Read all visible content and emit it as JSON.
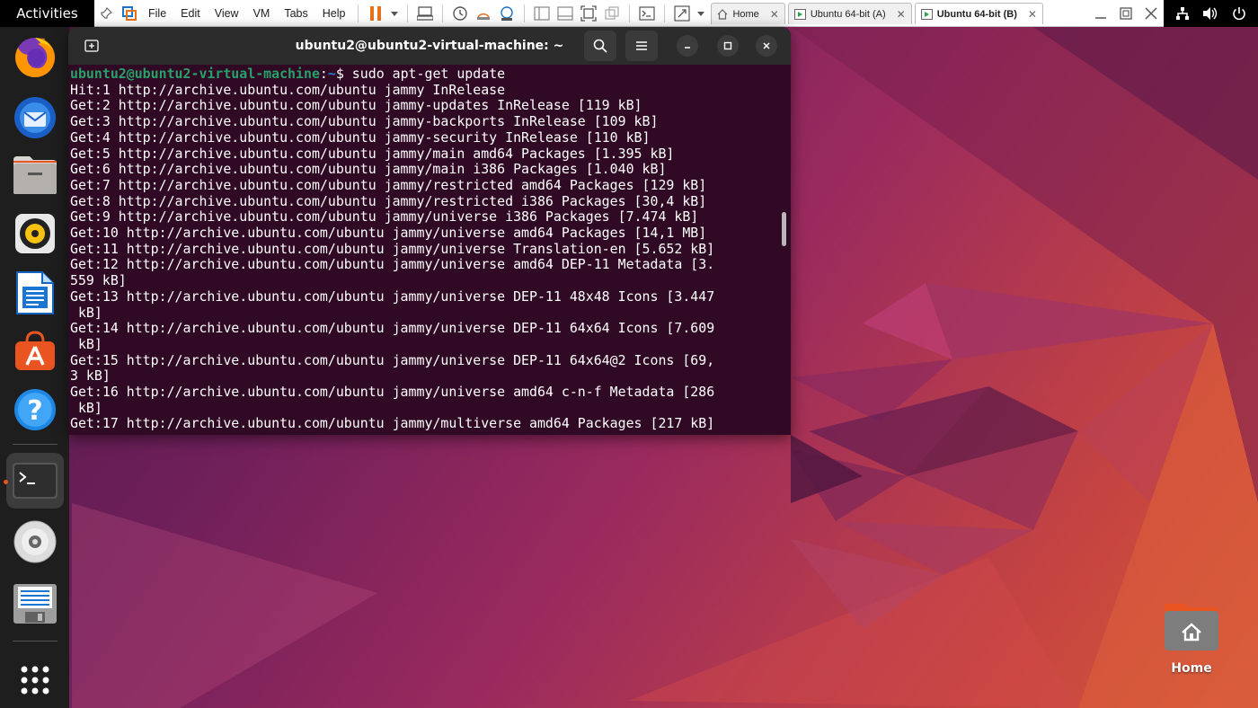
{
  "topbar": {
    "activities_label": "Activities"
  },
  "vmware": {
    "menu": [
      "File",
      "Edit",
      "View",
      "VM",
      "Tabs",
      "Help"
    ],
    "tabs": [
      {
        "label": "Home",
        "active": false
      },
      {
        "label": "Ubuntu 64-bit (A)",
        "active": false
      },
      {
        "label": "Ubuntu 64-bit (B)",
        "active": true
      }
    ],
    "accent_color": "#e8721c"
  },
  "dock": {
    "items": [
      {
        "name": "firefox-icon"
      },
      {
        "name": "thunderbird-icon"
      },
      {
        "name": "files-icon"
      },
      {
        "name": "rhythmbox-icon"
      },
      {
        "name": "libreoffice-writer-icon"
      },
      {
        "name": "app-center-icon"
      },
      {
        "name": "help-icon"
      },
      {
        "name": "terminal-icon",
        "running": true
      },
      {
        "name": "optical-disc-icon"
      },
      {
        "name": "floppy-save-icon"
      }
    ],
    "show_apps": "show-apps-icon"
  },
  "terminal": {
    "title": "ubuntu2@ubuntu2-virtual-machine: ~",
    "prompt_user": "ubuntu2@ubuntu2-virtual-machine",
    "prompt_path": "~",
    "prompt_suffix": "$ ",
    "command": "sudo apt-get update",
    "background": "#300a24",
    "output_lines": [
      "Hit:1 http://archive.ubuntu.com/ubuntu jammy InRelease",
      "Get:2 http://archive.ubuntu.com/ubuntu jammy-updates InRelease [119 kB]",
      "Get:3 http://archive.ubuntu.com/ubuntu jammy-backports InRelease [109 kB]",
      "Get:4 http://archive.ubuntu.com/ubuntu jammy-security InRelease [110 kB]",
      "Get:5 http://archive.ubuntu.com/ubuntu jammy/main amd64 Packages [1.395 kB]",
      "Get:6 http://archive.ubuntu.com/ubuntu jammy/main i386 Packages [1.040 kB]",
      "Get:7 http://archive.ubuntu.com/ubuntu jammy/restricted amd64 Packages [129 kB]",
      "Get:8 http://archive.ubuntu.com/ubuntu jammy/restricted i386 Packages [30,4 kB]",
      "Get:9 http://archive.ubuntu.com/ubuntu jammy/universe i386 Packages [7.474 kB]",
      "Get:10 http://archive.ubuntu.com/ubuntu jammy/universe amd64 Packages [14,1 MB]",
      "Get:11 http://archive.ubuntu.com/ubuntu jammy/universe Translation-en [5.652 kB]",
      "Get:12 http://archive.ubuntu.com/ubuntu jammy/universe amd64 DEP-11 Metadata [3.",
      "559 kB]",
      "Get:13 http://archive.ubuntu.com/ubuntu jammy/universe DEP-11 48x48 Icons [3.447",
      " kB]",
      "Get:14 http://archive.ubuntu.com/ubuntu jammy/universe DEP-11 64x64 Icons [7.609",
      " kB]",
      "Get:15 http://archive.ubuntu.com/ubuntu jammy/universe DEP-11 64x64@2 Icons [69,",
      "3 kB]",
      "Get:16 http://archive.ubuntu.com/ubuntu jammy/universe amd64 c-n-f Metadata [286",
      " kB]",
      "Get:17 http://archive.ubuntu.com/ubuntu jammy/multiverse amd64 Packages [217 kB]"
    ]
  },
  "desktop": {
    "home_label": "Home"
  }
}
